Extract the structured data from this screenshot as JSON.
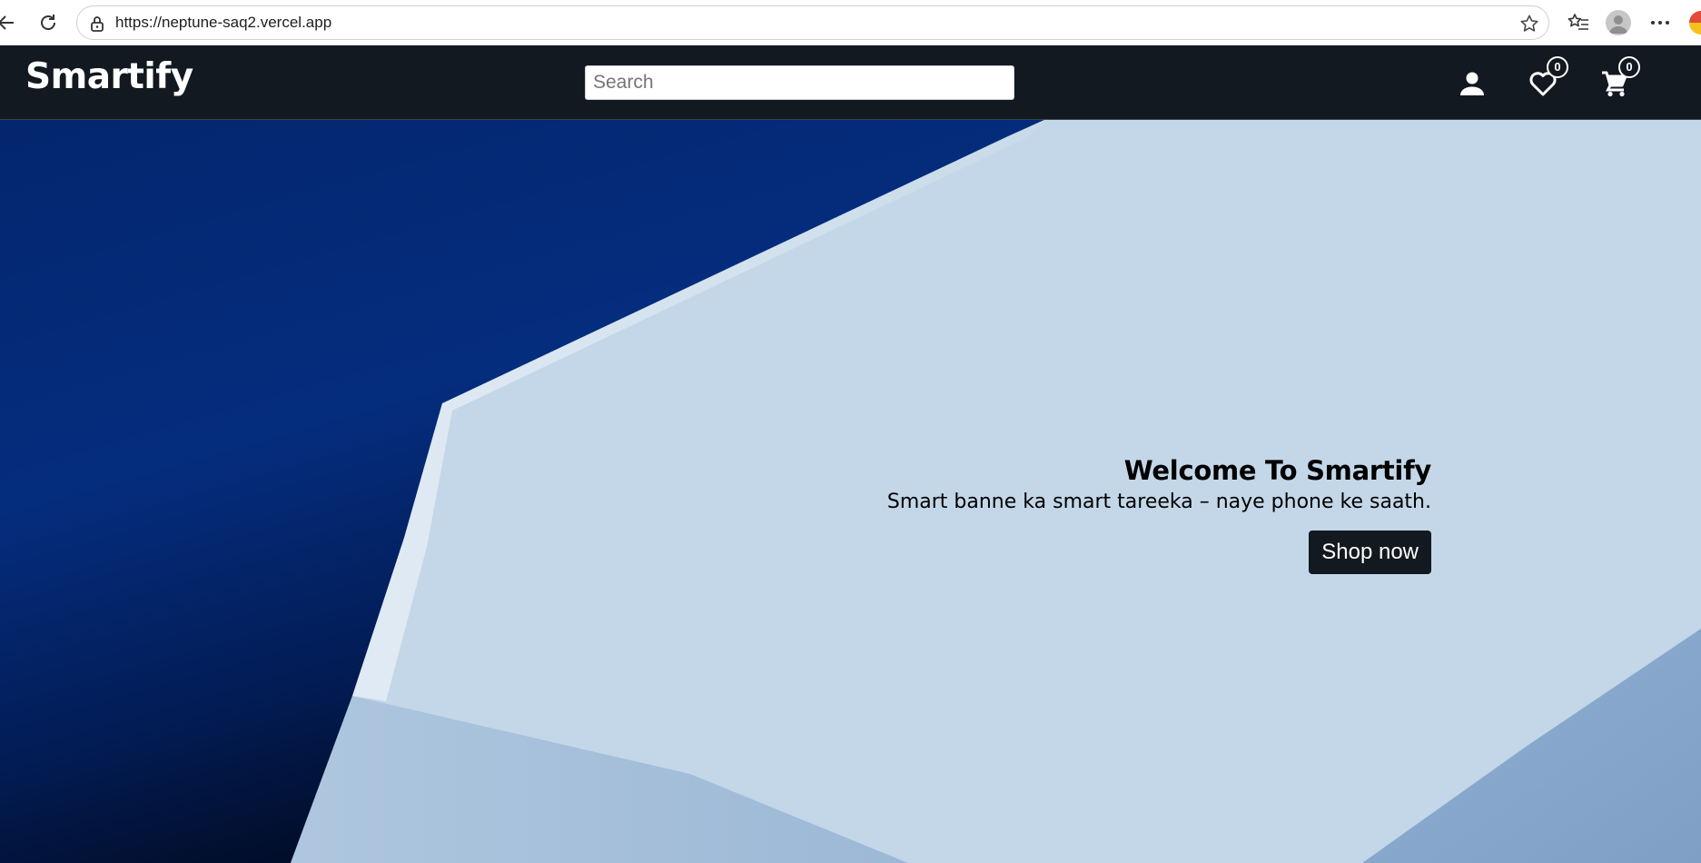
{
  "browser": {
    "url": "https://neptune-saq2.vercel.app",
    "icons": [
      "back-arrow-icon",
      "reload-icon",
      "lock-icon",
      "star-icon",
      "favorites-icon",
      "profile-icon",
      "more-icon",
      "edge-logo-icon"
    ]
  },
  "navbar": {
    "brand": "Smartify",
    "search_placeholder": "Search",
    "wishlist_count": "0",
    "cart_count": "0",
    "background": "#121920"
  },
  "hero": {
    "title": "Welcome To Smartify",
    "subtitle": "Smart banne ka smart tareeka – naye phone ke saath.",
    "button_label": "Shop now",
    "colors": {
      "dark_blue": "#032a78",
      "light_blue": "#c8dbe9"
    }
  }
}
